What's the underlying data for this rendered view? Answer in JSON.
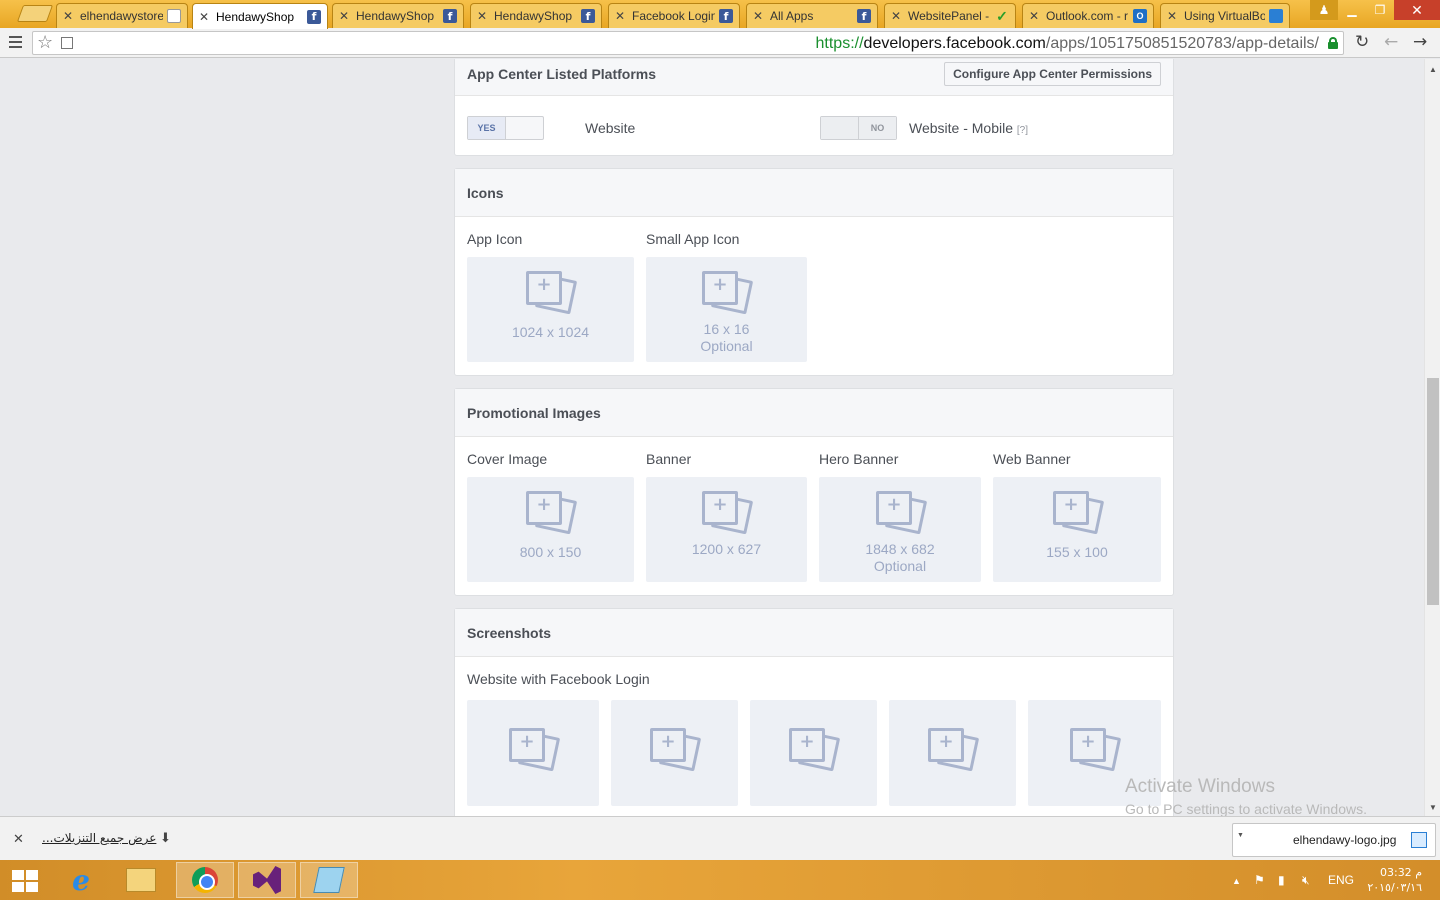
{
  "browser": {
    "tabs": [
      {
        "title": "elhendawystore",
        "favicon": "doc-icon",
        "active": false
      },
      {
        "title": "HendawyShop",
        "favicon": "facebook-icon",
        "active": true
      },
      {
        "title": "HendawyShop",
        "favicon": "facebook-icon",
        "active": false
      },
      {
        "title": "HendawyShop",
        "favicon": "facebook-icon",
        "active": false
      },
      {
        "title": "Facebook Login",
        "favicon": "facebook-icon",
        "active": false
      },
      {
        "title": "All Apps",
        "favicon": "facebook-icon",
        "active": false
      },
      {
        "title": "WebsitePanel -",
        "favicon": "checkmark-icon",
        "active": false
      },
      {
        "title": "Outlook.com - r",
        "favicon": "outlook-icon",
        "active": false
      },
      {
        "title": "Using VirtualBo",
        "favicon": "windows-icon",
        "active": false
      }
    ],
    "url": {
      "scheme": "https://",
      "host": "developers.facebook.com",
      "path": "/apps/1051750851520783/app-details/"
    }
  },
  "platforms": {
    "title": "App Center Listed Platforms",
    "configure_button": "Configure App Center Permissions",
    "website": {
      "toggle": "YES",
      "label": "Website"
    },
    "mobile": {
      "toggle": "NO",
      "label": "Website - Mobile",
      "help": "[?]"
    }
  },
  "icons": {
    "title": "Icons",
    "items": [
      {
        "label": "App Icon",
        "size": "1024 x 1024",
        "note": ""
      },
      {
        "label": "Small App Icon",
        "size": "16 x 16",
        "note": "Optional"
      }
    ]
  },
  "promo": {
    "title": "Promotional Images",
    "items": [
      {
        "label": "Cover Image",
        "size": "800 x 150",
        "note": ""
      },
      {
        "label": "Banner",
        "size": "1200 x 627",
        "note": ""
      },
      {
        "label": "Hero Banner",
        "size": "1848 x 682",
        "note": "Optional"
      },
      {
        "label": "Web Banner",
        "size": "155 x 100",
        "note": ""
      }
    ]
  },
  "screenshots": {
    "title": "Screenshots",
    "subtitle": "Website with Facebook Login"
  },
  "watermark": {
    "line1": "Activate Windows",
    "line2": "Go to PC settings to activate Windows."
  },
  "downloads": {
    "show_all": "عرض جميع التنزيلات...",
    "file": "elhendawy-logo.jpg"
  },
  "taskbar": {
    "lang": "ENG",
    "time": "03:32 م",
    "date": "٢٠١٥/٠٣/١٦"
  }
}
